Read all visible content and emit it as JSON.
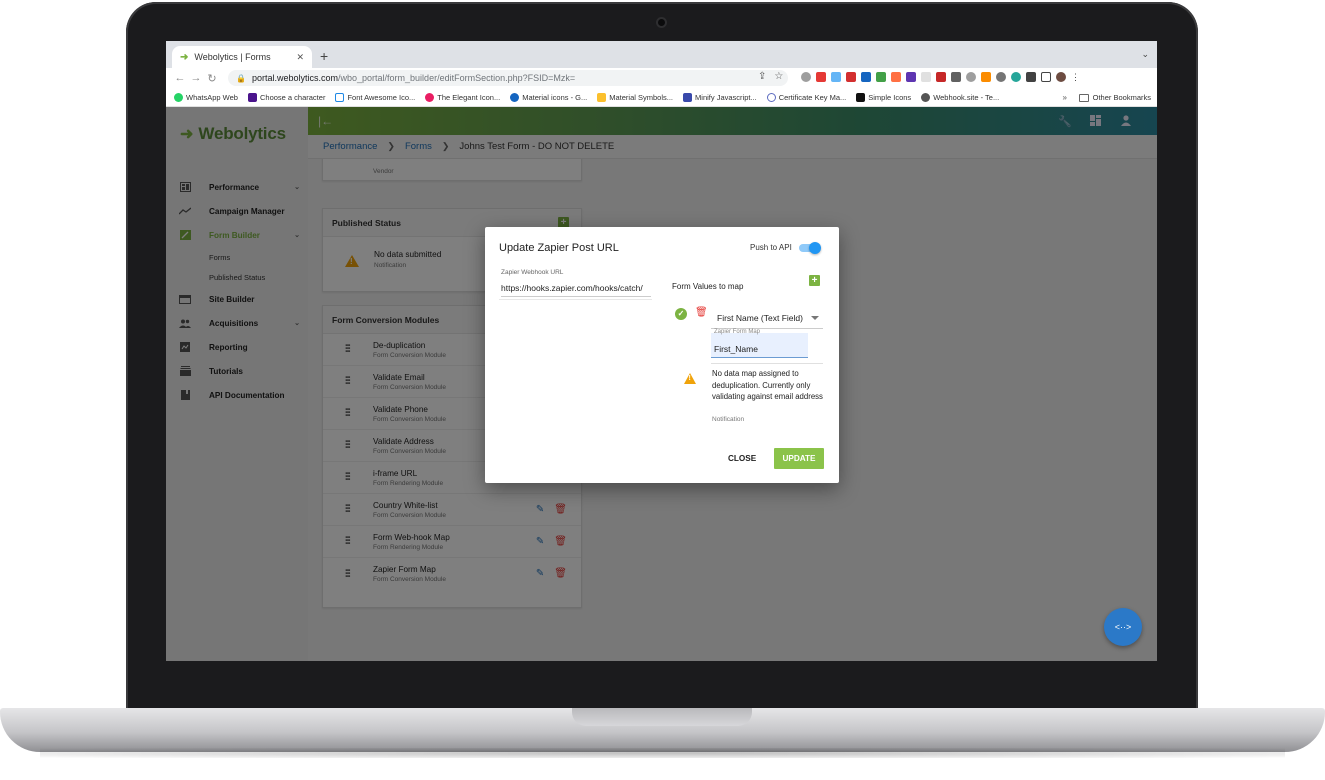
{
  "browser": {
    "tab_title": "Webolytics | Forms",
    "url_host": "portal.webolytics.com",
    "url_path": "/wbo_portal/form_builder/editFormSection.php?FSID=Mzk=",
    "bookmarks": [
      {
        "label": "WhatsApp Web",
        "color": "#25d366"
      },
      {
        "label": "Choose a character",
        "color": "#4a148c"
      },
      {
        "label": "Font Awesome Ico...",
        "color": "#1e88e5"
      },
      {
        "label": "The Elegant Icon...",
        "color": "#e91e63"
      },
      {
        "label": "Material icons - G...",
        "color": "#1565c0"
      },
      {
        "label": "Material Symbols...",
        "color": "#fbc02d"
      },
      {
        "label": "Minify Javascript...",
        "color": "#3949ab"
      },
      {
        "label": "Certificate Key Ma...",
        "color": "#5c6bc0"
      },
      {
        "label": "Simple Icons",
        "color": "#111111"
      },
      {
        "label": "Webhook.site - Te...",
        "color": "#555555"
      }
    ],
    "bookmarks_more": "»",
    "other_bookmarks": "Other Bookmarks"
  },
  "app": {
    "logo": "Webolytics",
    "nav": [
      {
        "label": "Performance",
        "icon": "dashboard-icon",
        "chevron": true
      },
      {
        "label": "Campaign Manager",
        "icon": "trending-icon",
        "chevron": false
      },
      {
        "label": "Form Builder",
        "icon": "edit-square-icon",
        "chevron": true,
        "active": true
      },
      {
        "label": "Site Builder",
        "icon": "web-icon",
        "chevron": false
      },
      {
        "label": "Acquisitions",
        "icon": "people-icon",
        "chevron": true
      },
      {
        "label": "Reporting",
        "icon": "report-icon",
        "chevron": false
      },
      {
        "label": "Tutorials",
        "icon": "tutorials-icon",
        "chevron": false
      },
      {
        "label": "API Documentation",
        "icon": "book-icon",
        "chevron": false
      }
    ],
    "nav_sub": [
      "Forms",
      "Published Status"
    ],
    "breadcrumb": {
      "items": [
        "Performance",
        "Forms"
      ],
      "current": "Johns Test Form - DO NOT DELETE"
    }
  },
  "cards": {
    "vendor_label": "Vendor",
    "published_status": {
      "title": "Published Status",
      "item_title": "No data submitted",
      "item_sub": "Notification"
    },
    "modules": {
      "title": "Form Conversion Modules",
      "items": [
        {
          "title": "De-duplication",
          "sub": "Form Conversion Module"
        },
        {
          "title": "Validate Email",
          "sub": "Form Conversion Module"
        },
        {
          "title": "Validate Phone",
          "sub": "Form Conversion Module"
        },
        {
          "title": "Validate Address",
          "sub": "Form Conversion Module"
        },
        {
          "title": "i-frame URL",
          "sub": "Form Rendering Module"
        },
        {
          "title": "Country White-list",
          "sub": "Form Conversion Module"
        },
        {
          "title": "Form Web-hook Map",
          "sub": "Form Rendering Module"
        },
        {
          "title": "Zapier Form Map",
          "sub": "Form Conversion Module"
        }
      ]
    }
  },
  "fab_label": "<··>",
  "modal": {
    "title": "Update Zapier Post URL",
    "push_label": "Push to API",
    "push_enabled": true,
    "webhook_label": "Zapier Webhook URL",
    "webhook_value": "https://hooks.zapier.com/hooks/catch/",
    "form_values_title": "Form Values to map",
    "field_select": "First Name (Text Field)",
    "map_label": "Zapier Form Map",
    "map_value": "First_Name",
    "note_text": "No data map assigned to deduplication. Currently only validating against email address",
    "note_sub": "Notification",
    "close_label": "CLOSE",
    "update_label": "UPDATE"
  },
  "colors": {
    "accent_green": "#7cb342",
    "link_blue": "#1e6fb8",
    "delete_red": "#e53935",
    "warning_orange": "#f0a30a"
  }
}
